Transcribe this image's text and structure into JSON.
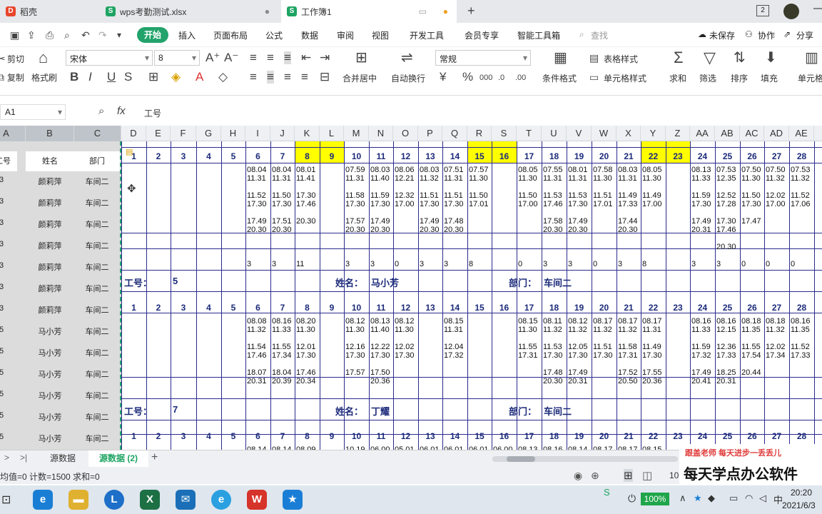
{
  "tabs": [
    {
      "label": "稻壳",
      "color": "#e8452c"
    },
    {
      "label": "wps考勤测试.xlsx",
      "color": "#1da462"
    },
    {
      "label": "工作簿1",
      "color": "#1da462"
    }
  ],
  "tab_badge": "2",
  "menu": {
    "start": "开始",
    "items": [
      "插入",
      "页面布局",
      "公式",
      "数据",
      "审阅",
      "视图",
      "开发工具",
      "会员专享",
      "智能工具箱"
    ],
    "search": "查找",
    "unsaved": "未保存",
    "collab": "协作",
    "share": "分享"
  },
  "ribbon": {
    "cut": "剪切",
    "copy": "复制",
    "format_painter": "格式刷",
    "font": "宋体",
    "font_size": "8",
    "number_format": "常规",
    "merge": "合并居中",
    "wrap": "自动换行",
    "cond_format": "条件格式",
    "table_style": "表格样式",
    "cell_style": "单元格样式",
    "sum": "求和",
    "filter": "筛选",
    "sort": "排序",
    "fill": "填充",
    "row_col": "单元格"
  },
  "formula_bar": {
    "cell_ref": "A1",
    "fx": "fx",
    "content": "工号"
  },
  "col_headers": [
    "A",
    "B",
    "C",
    "D",
    "E",
    "F",
    "G",
    "H",
    "I",
    "J",
    "K",
    "L",
    "M",
    "N",
    "O",
    "P",
    "Q",
    "R",
    "S",
    "T",
    "U",
    "V",
    "W",
    "X",
    "Y",
    "Z",
    "AA",
    "AB",
    "AC",
    "AD",
    "AE"
  ],
  "frozen": {
    "header": [
      "工号",
      "姓名",
      "部门"
    ],
    "rows": [
      [
        "3",
        "颜莉萍",
        "车间二"
      ],
      [
        "3",
        "颜莉萍",
        "车间二"
      ],
      [
        "3",
        "颜莉萍",
        "车间二"
      ],
      [
        "3",
        "颜莉萍",
        "车间二"
      ],
      [
        "3",
        "颜莉萍",
        "车间二"
      ],
      [
        "3",
        "颜莉萍",
        "车间二"
      ],
      [
        "3",
        "颜莉萍",
        "车间二"
      ],
      [
        "5",
        "马小芳",
        "车间二"
      ],
      [
        "5",
        "马小芳",
        "车间二"
      ],
      [
        "5",
        "马小芳",
        "车间二"
      ],
      [
        "5",
        "马小芳",
        "车间二"
      ],
      [
        "5",
        "马小芳",
        "车间二"
      ],
      [
        "5",
        "马小芳",
        "车间二"
      ]
    ]
  },
  "days": [
    "1",
    "2",
    "3",
    "4",
    "5",
    "6",
    "7",
    "8",
    "9",
    "10",
    "11",
    "12",
    "13",
    "14",
    "15",
    "16",
    "17",
    "18",
    "19",
    "20",
    "21",
    "22",
    "23",
    "24",
    "25",
    "26",
    "27",
    "28"
  ],
  "highlight_days": [
    "8",
    "9",
    "15",
    "16",
    "22",
    "23"
  ],
  "block1": {
    "times": {
      "6": "08.04\n11.31\n\n11.52\n17.30\n\n17.49\n20.30",
      "7": "08.04\n11.31\n\n11.50\n17.30\n\n17.51\n20.30",
      "8": "08.01\n11.41\n\n17.30\n17.46\n\n20.30",
      "10": "07.59\n11.31\n\n11.58\n17.30\n\n17.57\n20.30",
      "11": "08.03\n11.40\n\n11.59\n17.30\n\n17.49\n20.30",
      "12": "08.06\n12.21\n\n12.32\n17.00",
      "13": "08.03\n11.32\n\n11.51\n17.30\n\n17.49\n20.30",
      "14": "07.51\n11.31\n\n11.51\n17.30\n\n17.48\n20.30",
      "15": "07.57\n11.30\n\n11.50\n17.01",
      "17": "08.05\n11.30\n\n11.50\n17.00",
      "18": "07.55\n11.31\n\n11.53\n17.46\n\n17.58\n20.30",
      "19": "08.01\n11.31\n\n11.53\n17.30\n\n17.49\n20.30",
      "20": "07.58\n11.30\n\n11.51\n17.01",
      "21": "08.03\n11.31\n\n11.49\n17.33\n\n17.44\n20.30",
      "22": "08.05\n11.30\n\n11.49\n17.00",
      "24": "08.13\n11.33\n\n11.59\n17.30\n\n17.49\n20.31",
      "25": "07.53\n12.35\n\n12.52\n17.28\n\n17.30\n17.46\n\n20.30",
      "26": "07.50\n11.30\n\n11.50\n17.30\n\n17.47",
      "27": "07.50\n11.32\n\n12.02\n17.00",
      "28": "07.53\n11.32\n\n11.52\n17.06"
    },
    "counts": {
      "6": "3",
      "7": "3",
      "8": "11",
      "10": "3",
      "11": "3",
      "12": "0",
      "13": "3",
      "14": "3",
      "15": "8",
      "17": "0",
      "18": "3",
      "19": "3",
      "20": "0",
      "21": "3",
      "22": "8",
      "24": "3",
      "25": "3",
      "26": "0",
      "27": "0",
      "28": "0"
    }
  },
  "block2": {
    "id_label": "工号：",
    "id": "5",
    "name_label": "姓名：",
    "name": "马小芳",
    "dept_label": "部门：",
    "dept": "车间二",
    "times": {
      "6": "08.08\n11.32\n\n11.54\n17.46\n\n18.07\n20.31",
      "7": "08.16\n11.33\n\n11.55\n17.34\n\n18.04\n20.39",
      "8": "08.20\n11.30\n\n12.01\n17.30\n\n17.46\n20.34",
      "10": "08.12\n11.30\n\n12.16\n17.30\n\n17.57",
      "11": "08.13\n11.40\n\n12.22\n17.30\n\n17.50\n20.36",
      "12": "08.12\n11.30\n\n12.02\n17.30",
      "14": "08.15\n11.31\n\n12.04\n17.32",
      "17": "08.15\n11.30\n\n11.55\n17.31",
      "18": "08.11\n11.32\n\n11.53\n17.30\n\n17.48\n20.30",
      "19": "08.12\n11.32\n\n12.05\n17.30\n\n17.49\n20.31",
      "20": "08.17\n11.32\n\n11.51\n17.30",
      "21": "08.17\n11.32\n\n11.58\n17.31\n\n17.52\n20.50",
      "22": "08.17\n11.31\n\n11.49\n17.30\n\n17.55\n20.36",
      "24": "08.16\n11.33\n\n11.59\n17.32\n\n17.49\n20.41",
      "25": "08.16\n12.15\n\n12.36\n17.33\n\n18.25\n20.31",
      "26": "08.18\n11.35\n\n11.55\n17.54\n\n20.44",
      "27": "08.18\n11.32\n\n12.02\n17.34",
      "28": "08.16\n11.35\n\n11.52\n17.33"
    }
  },
  "block3": {
    "id_label": "工号：",
    "id": "7",
    "name_label": "姓名：",
    "name": "丁耀",
    "dept_label": "部门：",
    "dept": "车间二",
    "times": {
      "6": "08.14",
      "7": "08.14",
      "8": "08.09",
      "10": "10.19",
      "11": "06.00",
      "12": "05.01",
      "13": "06.01",
      "14": "06.01",
      "15": "06.01",
      "16": "06.00",
      "17": "08.13",
      "18": "08.16",
      "19": "08.14",
      "20": "08.17",
      "21": "08.17",
      "22": "08.15"
    }
  },
  "sheet_tabs": [
    "源数据",
    "源数据 (2)"
  ],
  "status": {
    "text": "均值=0  计数=1500  求和=0",
    "zoom": "10"
  },
  "watermark": {
    "line1": "跟盖老师  每天进步一丢丢儿",
    "line2": "每天学点办公软件"
  },
  "taskbar": {
    "battery": "100%",
    "time": "20:20",
    "date": "2021/6/3"
  }
}
